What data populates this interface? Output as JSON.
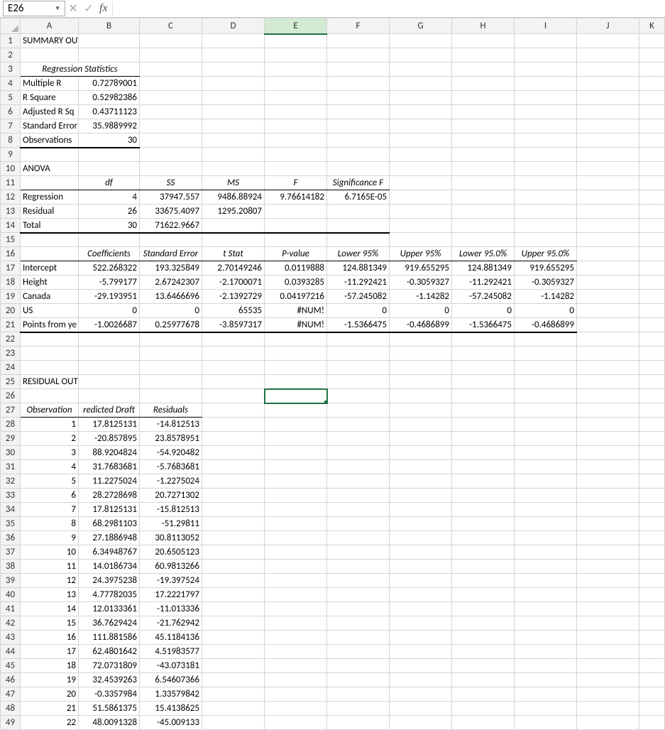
{
  "nameBox": "E26",
  "fxLabel": "fx",
  "columns": [
    "A",
    "B",
    "C",
    "D",
    "E",
    "F",
    "G",
    "H",
    "I",
    "J",
    "K"
  ],
  "selectedCol": "E",
  "selectedRow": 26,
  "summary_title": "SUMMARY OUTPUT",
  "regstats_title": "Regression Statistics",
  "regstats": [
    {
      "label": "Multiple R",
      "val": "0.72789001"
    },
    {
      "label": "R Square",
      "val": "0.52982386"
    },
    {
      "label": "Adjusted R Sq",
      "val": "0.43711123"
    },
    {
      "label": "Standard Error",
      "val": "35.9889992"
    },
    {
      "label": "Observations",
      "val": "30"
    }
  ],
  "anova_title": "ANOVA",
  "anova_hdr": {
    "df": "df",
    "ss": "SS",
    "ms": "MS",
    "f": "F",
    "sig": "Significance F"
  },
  "anova": [
    {
      "src": "Regression",
      "df": "4",
      "ss": "37947.557",
      "ms": "9486.88924",
      "f": "9.76614182",
      "sig": "6.7165E-05"
    },
    {
      "src": "Residual",
      "df": "26",
      "ss": "33675.4097",
      "ms": "1295.20807",
      "f": "",
      "sig": ""
    },
    {
      "src": "Total",
      "df": "30",
      "ss": "71622.9667",
      "ms": "",
      "f": "",
      "sig": ""
    }
  ],
  "coef_hdr": {
    "coef": "Coefficients",
    "se": "Standard Error",
    "t": "t Stat",
    "p": "P-value",
    "l95": "Lower 95%",
    "u95": "Upper 95%",
    "l95b": "Lower 95.0%",
    "u95b": "Upper 95.0%"
  },
  "coefs": [
    {
      "name": "Intercept",
      "coef": "522.268322",
      "se": "193.325849",
      "t": "2.70149246",
      "p": "0.0119888",
      "l95": "124.881349",
      "u95": "919.655295",
      "l95b": "124.881349",
      "u95b": "919.655295"
    },
    {
      "name": "Height",
      "coef": "-5.799177",
      "se": "2.67242307",
      "t": "-2.1700071",
      "p": "0.0393285",
      "l95": "-11.292421",
      "u95": "-0.3059327",
      "l95b": "-11.292421",
      "u95b": "-0.3059327"
    },
    {
      "name": "Canada",
      "coef": "-29.193951",
      "se": "13.6466696",
      "t": "-2.1392729",
      "p": "0.04197216",
      "l95": "-57.245082",
      "u95": "-1.14282",
      "l95b": "-57.245082",
      "u95b": "-1.14282"
    },
    {
      "name": "US",
      "coef": "0",
      "se": "0",
      "t": "65535",
      "p": "#NUM!",
      "l95": "0",
      "u95": "0",
      "l95b": "0",
      "u95b": "0"
    },
    {
      "name": "Points from ye",
      "coef": "-1.0026687",
      "se": "0.25977678",
      "t": "-3.8597317",
      "p": "#NUM!",
      "l95": "-1.5366475",
      "u95": "-0.4686899",
      "l95b": "-1.5366475",
      "u95b": "-0.4686899"
    }
  ],
  "residual_title": "RESIDUAL OUTPUT",
  "res_hdr": {
    "obs": "Observation",
    "pred": "redicted Draft",
    "resid": "Residuals"
  },
  "residuals": [
    {
      "obs": "1",
      "pred": "17.8125131",
      "resid": "-14.812513"
    },
    {
      "obs": "2",
      "pred": "-20.857895",
      "resid": "23.8578951"
    },
    {
      "obs": "3",
      "pred": "88.9204824",
      "resid": "-54.920482"
    },
    {
      "obs": "4",
      "pred": "31.7683681",
      "resid": "-5.7683681"
    },
    {
      "obs": "5",
      "pred": "11.2275024",
      "resid": "-1.2275024"
    },
    {
      "obs": "6",
      "pred": "28.2728698",
      "resid": "20.7271302"
    },
    {
      "obs": "7",
      "pred": "17.8125131",
      "resid": "-15.812513"
    },
    {
      "obs": "8",
      "pred": "68.2981103",
      "resid": "-51.29811"
    },
    {
      "obs": "9",
      "pred": "27.1886948",
      "resid": "30.8113052"
    },
    {
      "obs": "10",
      "pred": "6.34948767",
      "resid": "20.6505123"
    },
    {
      "obs": "11",
      "pred": "14.0186734",
      "resid": "60.9813266"
    },
    {
      "obs": "12",
      "pred": "24.3975238",
      "resid": "-19.397524"
    },
    {
      "obs": "13",
      "pred": "4.77782035",
      "resid": "17.2221797"
    },
    {
      "obs": "14",
      "pred": "12.0133361",
      "resid": "-11.013336"
    },
    {
      "obs": "15",
      "pred": "36.7629424",
      "resid": "-21.762942"
    },
    {
      "obs": "16",
      "pred": "111.881586",
      "resid": "45.1184136"
    },
    {
      "obs": "17",
      "pred": "62.4801642",
      "resid": "4.51983577"
    },
    {
      "obs": "18",
      "pred": "72.0731809",
      "resid": "-43.073181"
    },
    {
      "obs": "19",
      "pred": "32.4539263",
      "resid": "6.54607366"
    },
    {
      "obs": "20",
      "pred": "-0.3357984",
      "resid": "1.33579842"
    },
    {
      "obs": "21",
      "pred": "51.5861375",
      "resid": "15.4138625"
    },
    {
      "obs": "22",
      "pred": "48.0091328",
      "resid": "-45.009133"
    }
  ]
}
